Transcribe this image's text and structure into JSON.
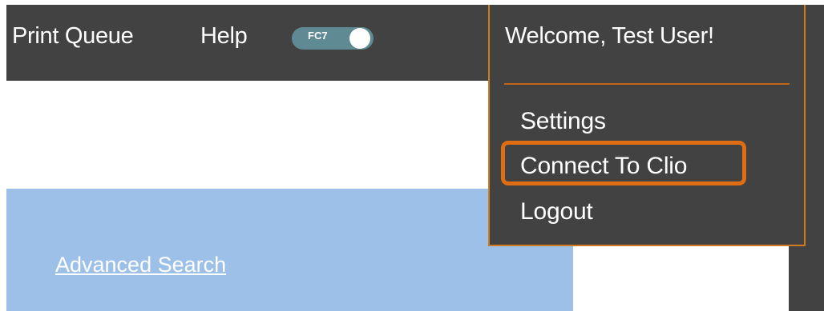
{
  "nav": {
    "print_queue": "Print Queue",
    "help": "Help",
    "toggle_label": "FC7"
  },
  "user_menu": {
    "welcome": "Welcome, Test User!",
    "items": [
      {
        "label": "Settings"
      },
      {
        "label": "Connect To Clio",
        "highlighted": true
      },
      {
        "label": "Logout"
      }
    ]
  },
  "content": {
    "advanced_search": "Advanced Search"
  },
  "colors": {
    "topbar": "#424242",
    "accent_border": "#d17a1e",
    "highlight": "#e06c13",
    "panel": "#9dc0e9",
    "toggle": "#5f8a94"
  }
}
